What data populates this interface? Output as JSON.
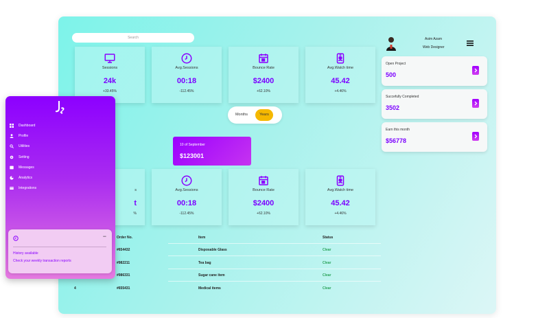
{
  "search": {
    "placeholder": "Search"
  },
  "stats_top": [
    {
      "title": "Sessions",
      "value": "24k",
      "change": "+33.45%",
      "icon": "monitor-icon"
    },
    {
      "title": "Avg.Sessions",
      "value": "00:18",
      "change": "-112.45%",
      "icon": "clock-icon"
    },
    {
      "title": "Bounce Rate",
      "value": "$2400",
      "change": "+62.10%",
      "icon": "calendar-icon"
    },
    {
      "title": "Avg.Watch time",
      "value": "45.42",
      "change": "+4.46%",
      "icon": "id-badge-icon"
    }
  ],
  "toggle": {
    "months": "Months",
    "years": "Years",
    "active": "years"
  },
  "date_card": {
    "label": "10 of September",
    "amount": "$123001"
  },
  "stats_bottom": [
    {
      "title": "s",
      "value": "t",
      "change": "%",
      "icon": "monitor-icon"
    },
    {
      "title": "Avg.Sessions",
      "value": "00:18",
      "change": "-112.45%",
      "icon": "clock-icon"
    },
    {
      "title": "Bounce Rate",
      "value": "$2400",
      "change": "+62.10%",
      "icon": "calendar-icon"
    },
    {
      "title": "Avg.Watch time",
      "value": "45.42",
      "change": "+4.46%",
      "icon": "id-badge-icon"
    }
  ],
  "table": {
    "headers": [
      "Order No.",
      "Item",
      "Status"
    ],
    "rows": [
      {
        "no": "",
        "order": "#654432",
        "item": "Disposable Glass",
        "status": "Clear"
      },
      {
        "no": "",
        "order": "#982211",
        "item": "Tea bag",
        "status": "Clear"
      },
      {
        "no": "",
        "order": "#986331",
        "item": "Sugar cane item",
        "status": "Clear"
      },
      {
        "no": "4",
        "order": "#655431",
        "item": "Medical items",
        "status": "Clear"
      }
    ]
  },
  "profile": {
    "name": "Asim Azam",
    "role": "Web Designer"
  },
  "info_cards": [
    {
      "label": "Open Project",
      "value": "500"
    },
    {
      "label": "Succefully Completed",
      "value": "3502"
    },
    {
      "label": "Earn this month",
      "value": "$56778"
    }
  ],
  "sidebar": {
    "items": [
      {
        "label": "Dashboard",
        "icon": "dashboard-icon"
      },
      {
        "label": "Profile",
        "icon": "user-icon"
      },
      {
        "label": "Utilities",
        "icon": "search-icon"
      },
      {
        "label": "Setting",
        "icon": "gear-icon"
      },
      {
        "label": "Messages",
        "icon": "message-icon"
      },
      {
        "label": "Analytics",
        "icon": "chart-icon"
      },
      {
        "label": "Integrations",
        "icon": "integrations-icon"
      }
    ],
    "history": {
      "minus": "−",
      "title": "History available",
      "subtitle": "Check your weekly transaction reports"
    }
  },
  "colors": {
    "accent": "#7b00ff",
    "sidebar_top": "#8c00ff",
    "toggle_active": "#f5b800",
    "status_clear": "#2aa35a",
    "dashboard_bg": "#7df3ea"
  }
}
